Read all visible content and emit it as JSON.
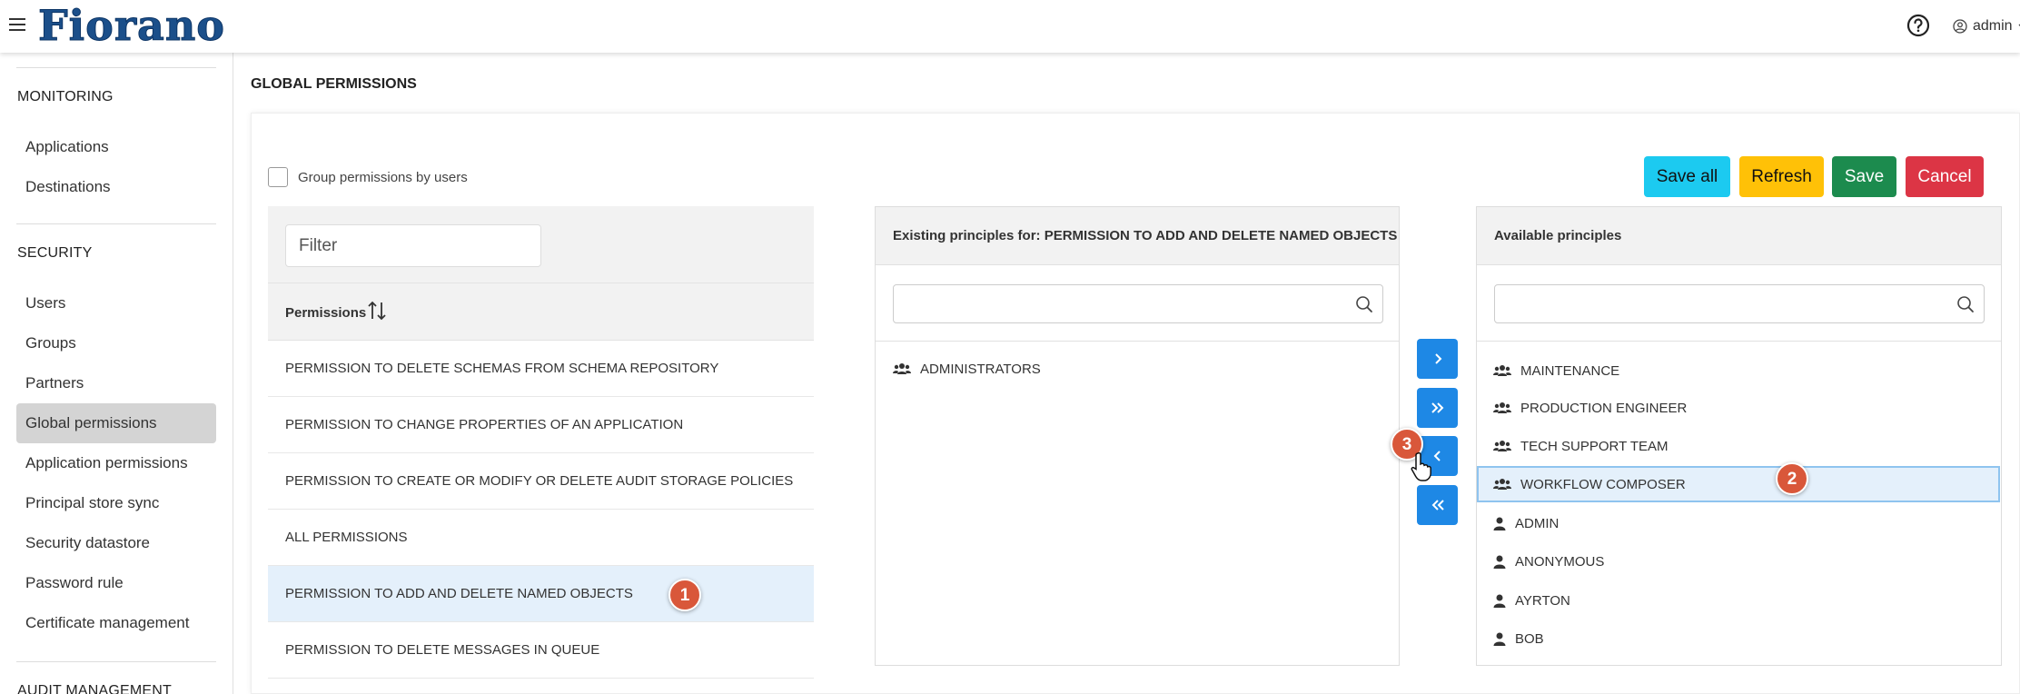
{
  "header": {
    "logo_text": "Fiorano",
    "user_label": "admin"
  },
  "sidebar": {
    "sections": [
      {
        "title": "MONITORING",
        "items": [
          "Applications",
          "Destinations"
        ]
      },
      {
        "title": "SECURITY",
        "items": [
          "Users",
          "Groups",
          "Partners",
          "Global permissions",
          "Application permissions",
          "Principal store sync",
          "Security datastore",
          "Password rule",
          "Certificate management"
        ]
      },
      {
        "title": "AUDIT MANAGEMENT",
        "items": []
      }
    ],
    "active_item": "Global permissions"
  },
  "main": {
    "page_title": "GLOBAL PERMISSIONS",
    "group_by_users_label": "Group permissions by users",
    "group_by_users_checked": false,
    "buttons": {
      "save_all": "Save all",
      "refresh": "Refresh",
      "save": "Save",
      "cancel": "Cancel"
    },
    "permissions": {
      "filter_placeholder": "Filter",
      "header": "Permissions",
      "rows": [
        "PERMISSION TO DELETE SCHEMAS FROM SCHEMA REPOSITORY",
        "PERMISSION TO CHANGE PROPERTIES OF AN APPLICATION",
        "PERMISSION TO CREATE OR MODIFY OR DELETE AUDIT STORAGE POLICIES",
        "ALL PERMISSIONS",
        "PERMISSION TO ADD AND DELETE NAMED OBJECTS",
        "PERMISSION TO DELETE MESSAGES IN QUEUE"
      ],
      "selected_index": 4
    },
    "existing": {
      "header": "Existing principles for: PERMISSION TO ADD AND DELETE NAMED OBJECTS",
      "search_value": "",
      "principals": [
        {
          "name": "ADMINISTRATORS",
          "type": "group"
        }
      ]
    },
    "available": {
      "header": "Available principles",
      "search_value": "",
      "principals": [
        {
          "name": "MAINTENANCE",
          "type": "group"
        },
        {
          "name": "PRODUCTION ENGINEER",
          "type": "group"
        },
        {
          "name": "TECH SUPPORT TEAM",
          "type": "group"
        },
        {
          "name": "WORKFLOW COMPOSER",
          "type": "group"
        },
        {
          "name": "ADMIN",
          "type": "user"
        },
        {
          "name": "ANONYMOUS",
          "type": "user"
        },
        {
          "name": "AYRTON",
          "type": "user"
        },
        {
          "name": "BOB",
          "type": "user"
        }
      ],
      "selected_index": 3
    },
    "move_buttons": [
      {
        "name": "move-right-button",
        "icon": "chevron-right-icon"
      },
      {
        "name": "move-all-right-button",
        "icon": "double-chevron-right-icon"
      },
      {
        "name": "move-left-button",
        "icon": "chevron-left-icon"
      },
      {
        "name": "move-all-left-button",
        "icon": "double-chevron-left-icon"
      }
    ]
  },
  "callouts": [
    "1",
    "2",
    "3"
  ],
  "colors": {
    "accent": "#1e88e5",
    "save_all": "#1ccaf0",
    "refresh": "#ffc107",
    "save": "#1c8b4e",
    "cancel": "#dc3545",
    "callout": "#d9573a",
    "selected_row": "#e4f0fb",
    "logo": "#1b4f8a"
  }
}
